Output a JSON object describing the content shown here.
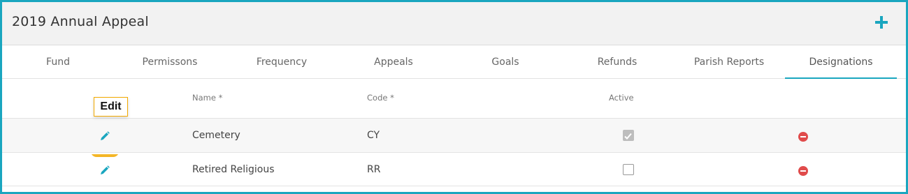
{
  "panel": {
    "title": "2019 Annual Appeal",
    "add_icon": "plus-icon",
    "accent_color": "#1aa6bf"
  },
  "tabs": [
    {
      "label": "Fund"
    },
    {
      "label": "Permissons"
    },
    {
      "label": "Frequency"
    },
    {
      "label": "Appeals"
    },
    {
      "label": "Goals"
    },
    {
      "label": "Refunds"
    },
    {
      "label": "Parish Reports"
    },
    {
      "label": "Designations",
      "active": true
    }
  ],
  "table": {
    "columns": {
      "name": "Name *",
      "code": "Code *",
      "active": "Active"
    },
    "rows": [
      {
        "name": "Cemetery",
        "code": "CY",
        "active": true
      },
      {
        "name": "Retired Religious",
        "code": "RR",
        "active": false
      }
    ],
    "edit_icon": "pencil-icon",
    "remove_icon": "minus-circle-icon",
    "remove_color": "#e04b4b"
  },
  "tooltip": {
    "text": "Edit",
    "border_color": "#f2a900"
  }
}
